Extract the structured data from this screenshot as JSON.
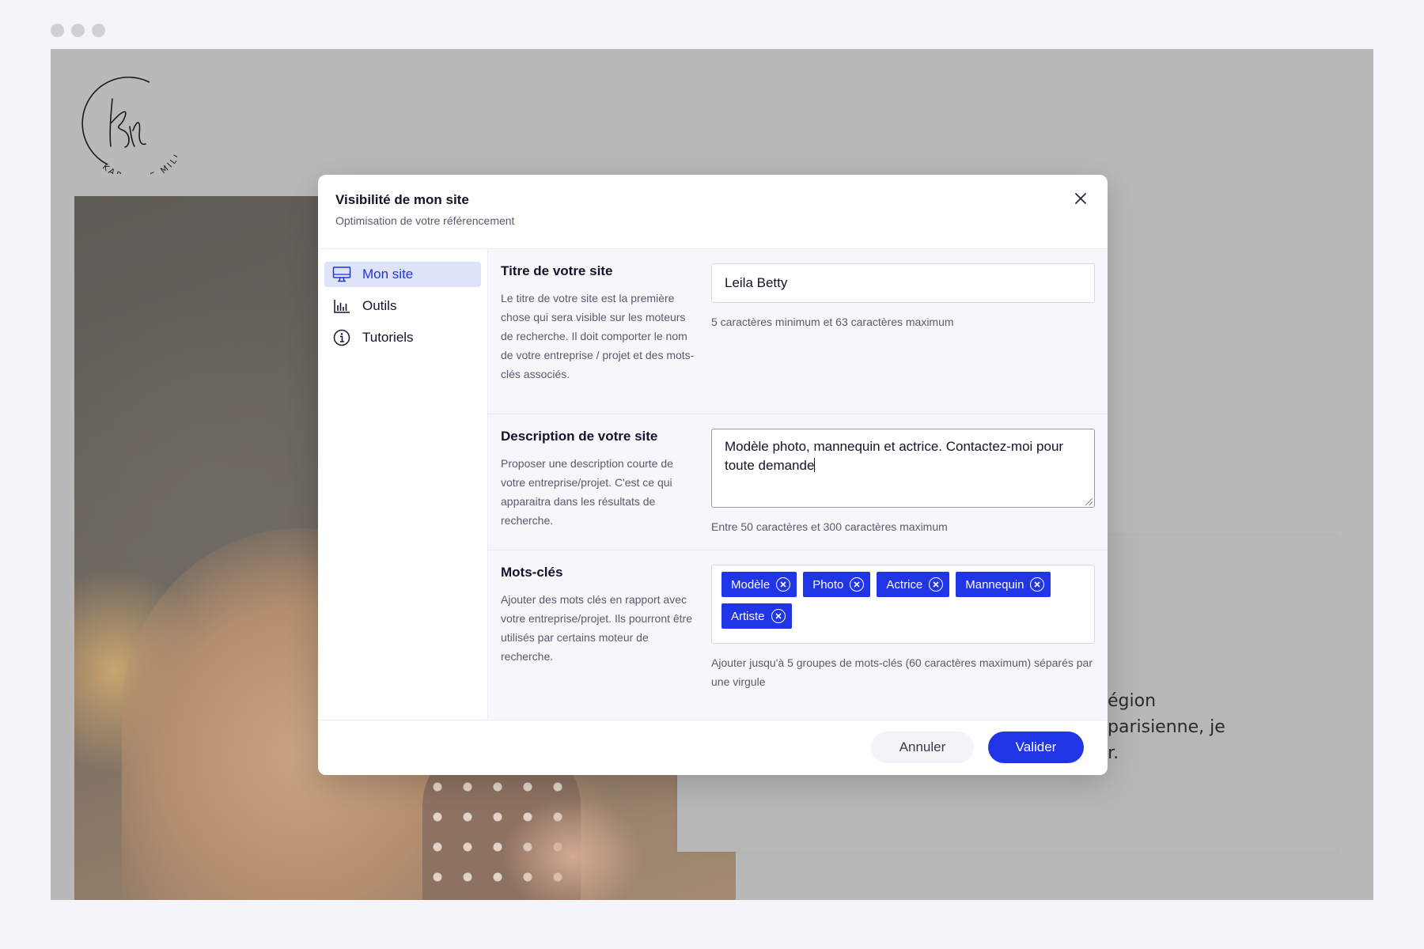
{
  "background": {
    "logo_text": "KAROLINE MILLAUD",
    "card_text_line1": "égion parisienne, je",
    "card_text_line2": "peux aussi me déplacer en France et à l'étranger."
  },
  "modal": {
    "title": "Visibilité de mon site",
    "subtitle": "Optimisation de votre référencement",
    "close_icon": "close-icon"
  },
  "sidebar": {
    "items": [
      {
        "label": "Mon site",
        "icon": "monitor-icon",
        "active": true
      },
      {
        "label": "Outils",
        "icon": "bar-chart-icon",
        "active": false
      },
      {
        "label": "Tutoriels",
        "icon": "info-icon",
        "active": false
      }
    ]
  },
  "sections": {
    "title": {
      "heading": "Titre de votre site",
      "description": "Le titre de votre site est la première chose qui sera visible sur les moteurs de recherche. Il doit comporter le nom de votre entreprise / projet et des mots-clés associés.",
      "value": "Leila Betty",
      "hint": "5 caractères minimum et 63 caractères maximum"
    },
    "description": {
      "heading": "Description de votre site",
      "description": "Proposer une description courte de votre entreprise/projet. C'est ce qui apparaitra dans les résultats de recherche.",
      "value": "Modèle photo, mannequin et actrice. Contactez-moi pour toute demande",
      "hint": "Entre 50 caractères et 300 caractères maximum"
    },
    "keywords": {
      "heading": "Mots-clés",
      "description": "Ajouter des mots clés en rapport avec votre entreprise/projet. Ils pourront être utilisés par certains moteur de recherche.",
      "tags": [
        "Modèle",
        "Photo",
        "Actrice",
        "Mannequin",
        "Artiste"
      ],
      "hint": "Ajouter jusqu'à 5 groupes de mots-clés (60 caractères maximum) séparés par une virgule"
    }
  },
  "footer": {
    "cancel_label": "Annuler",
    "submit_label": "Valider"
  },
  "colors": {
    "accent": "#1f35e6",
    "active_nav_bg": "#dfe3fa",
    "overlay": "#b9b9b9"
  }
}
